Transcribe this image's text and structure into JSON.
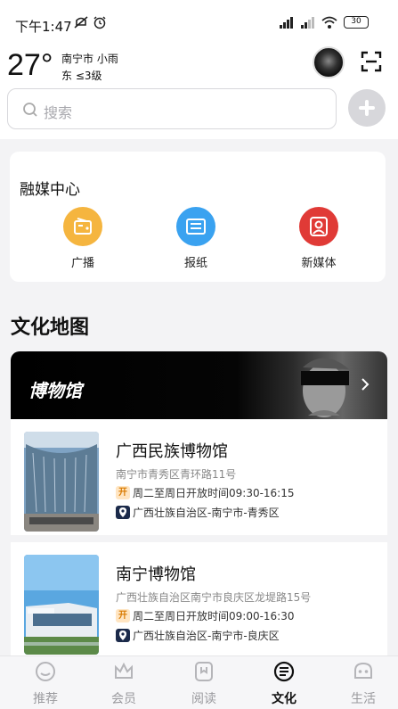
{
  "status_bar": {
    "time": "下午1:47",
    "battery": "30"
  },
  "weather": {
    "temperature": "27°",
    "city_condition": "南宁市 小雨",
    "wind": "东 ≤3级"
  },
  "search": {
    "placeholder": "搜索"
  },
  "media_center": {
    "title": "融媒中心",
    "items": [
      {
        "label": "广播",
        "icon": "radio-icon",
        "color": "#f5b53f"
      },
      {
        "label": "报纸",
        "icon": "newspaper-icon",
        "color": "#3aa2f0"
      },
      {
        "label": "新媒体",
        "icon": "new-media-icon",
        "color": "#e03a36"
      }
    ]
  },
  "culture_map": {
    "title": "文化地图",
    "banner_title": "博物馆",
    "museums": [
      {
        "name": "广西民族博物馆",
        "address": "南宁市青秀区青环路11号",
        "open_tag": "开",
        "hours": "周二至周日开放时间09:30-16:15",
        "location": "广西壮族自治区-南宁市-青秀区"
      },
      {
        "name": "南宁博物馆",
        "address": "广西壮族自治区南宁市良庆区龙堤路15号",
        "open_tag": "开",
        "hours": "周二至周日开放时间09:00-16:30",
        "location": "广西壮族自治区-南宁市-良庆区"
      }
    ]
  },
  "tabs": [
    {
      "label": "推荐",
      "icon": "recommend-icon",
      "active": false
    },
    {
      "label": "会员",
      "icon": "crown-icon",
      "active": false
    },
    {
      "label": "阅读",
      "icon": "book-icon",
      "active": false
    },
    {
      "label": "文化",
      "icon": "culture-icon",
      "active": true
    },
    {
      "label": "生活",
      "icon": "life-icon",
      "active": false
    }
  ],
  "colors": {
    "active_tab": "#111111",
    "inactive_tab": "#9a9a9e"
  }
}
